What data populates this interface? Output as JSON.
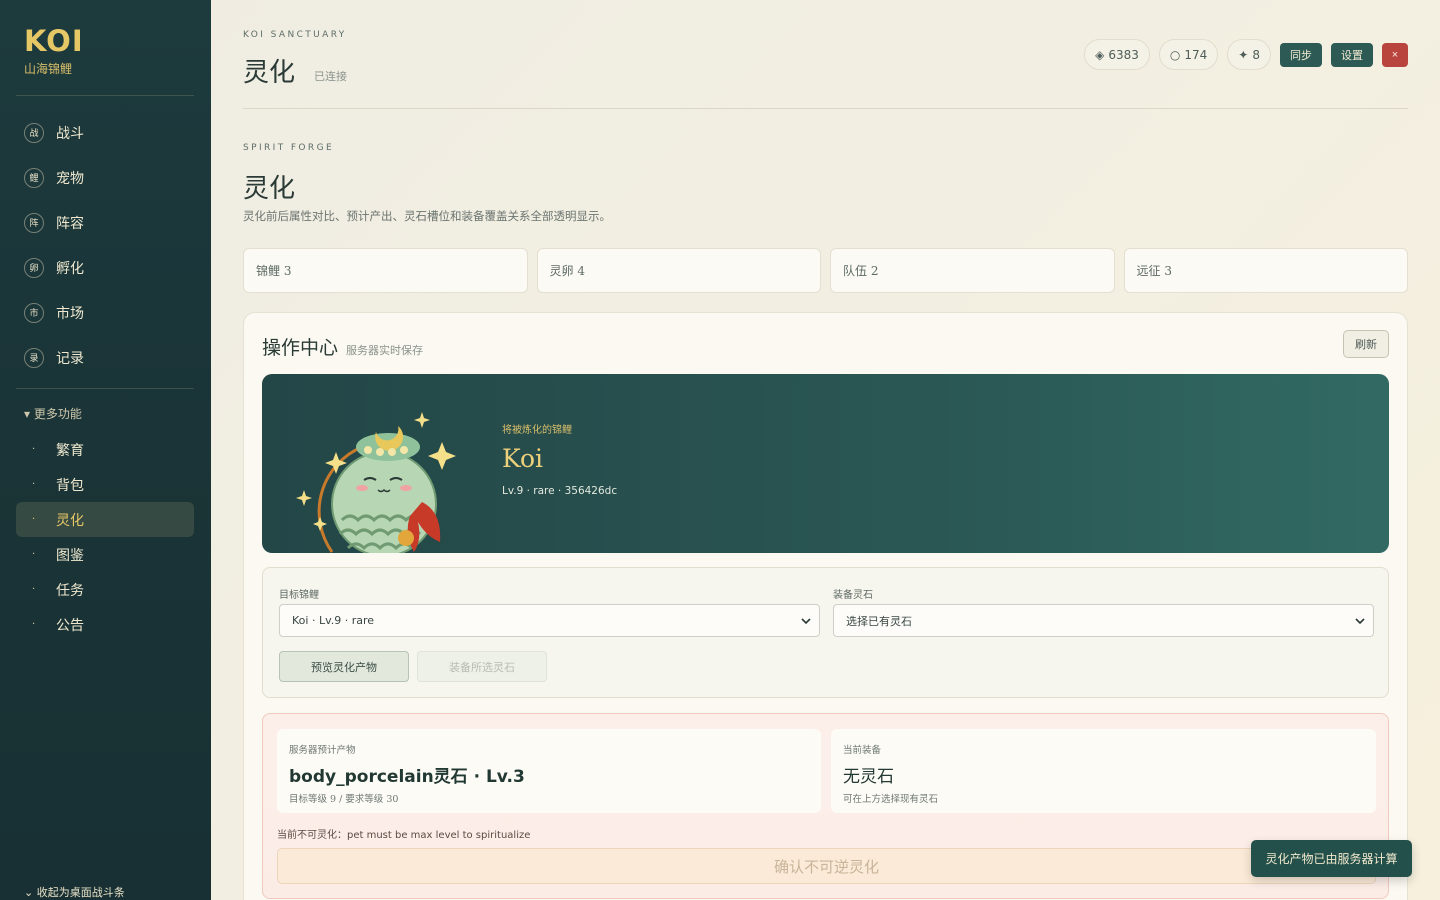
{
  "brand": {
    "title": "KOI",
    "subtitle": "山海锦鲤"
  },
  "nav": {
    "main": [
      {
        "badge": "战",
        "label": "战斗"
      },
      {
        "badge": "鲤",
        "label": "宠物"
      },
      {
        "badge": "阵",
        "label": "阵容"
      },
      {
        "badge": "卵",
        "label": "孵化"
      },
      {
        "badge": "市",
        "label": "市场"
      },
      {
        "badge": "录",
        "label": "记录"
      }
    ],
    "more_label": "▾ 更多功能",
    "sub": [
      {
        "dot": "·",
        "label": "繁育"
      },
      {
        "dot": "·",
        "label": "背包"
      },
      {
        "dot": "·",
        "label": "灵化"
      },
      {
        "dot": "·",
        "label": "图鉴"
      },
      {
        "dot": "·",
        "label": "任务"
      },
      {
        "dot": "·",
        "label": "公告"
      }
    ],
    "collapse_label": "⌄ 收起为桌面战斗条"
  },
  "header": {
    "eyebrow": "KOI SANCTUARY",
    "title": "灵化",
    "status": "已连接",
    "currencies": [
      {
        "icon": "◈",
        "value": "6383"
      },
      {
        "icon": "○",
        "value": "174"
      },
      {
        "icon": "✦",
        "value": "8"
      }
    ],
    "sync_label": "同步",
    "settings_label": "设置",
    "close_label": "×"
  },
  "section": {
    "eyebrow": "SPIRIT FORGE",
    "title": "灵化",
    "description": "灵化前后属性对比、预计产出、灵石槽位和装备覆盖关系全部透明显示。"
  },
  "stats": [
    "锦鲤 3",
    "灵卵 4",
    "队伍 2",
    "远征 3"
  ],
  "ops": {
    "title": "操作中心",
    "subtitle": "服务器实时保存",
    "refresh_label": "刷新",
    "hero": {
      "eyebrow": "将被炼化的锦鲤",
      "name": "Koi",
      "meta": "Lv.9 · rare · 356426dc"
    },
    "form": {
      "target_label": "目标锦鲤",
      "target_value": "Koi · Lv.9 · rare",
      "stone_label": "装备灵石",
      "stone_value": "选择已有灵石",
      "preview_label": "预览灵化产物",
      "equip_label": "装备所选灵石"
    },
    "prediction": {
      "output_label": "服务器预计产物",
      "output_value": "body_porcelain灵石 · Lv.3",
      "output_note": "目标等级 9 / 要求等级 30",
      "current_label": "当前装备",
      "current_value": "无灵石",
      "current_note": "可在上方选择现有灵石",
      "warn_prefix": "当前不可灵化：",
      "warn_reason": "pet must be max level to spiritualize",
      "confirm_label": "确认不可逆灵化"
    }
  },
  "toast": "灵化产物已由服务器计算"
}
